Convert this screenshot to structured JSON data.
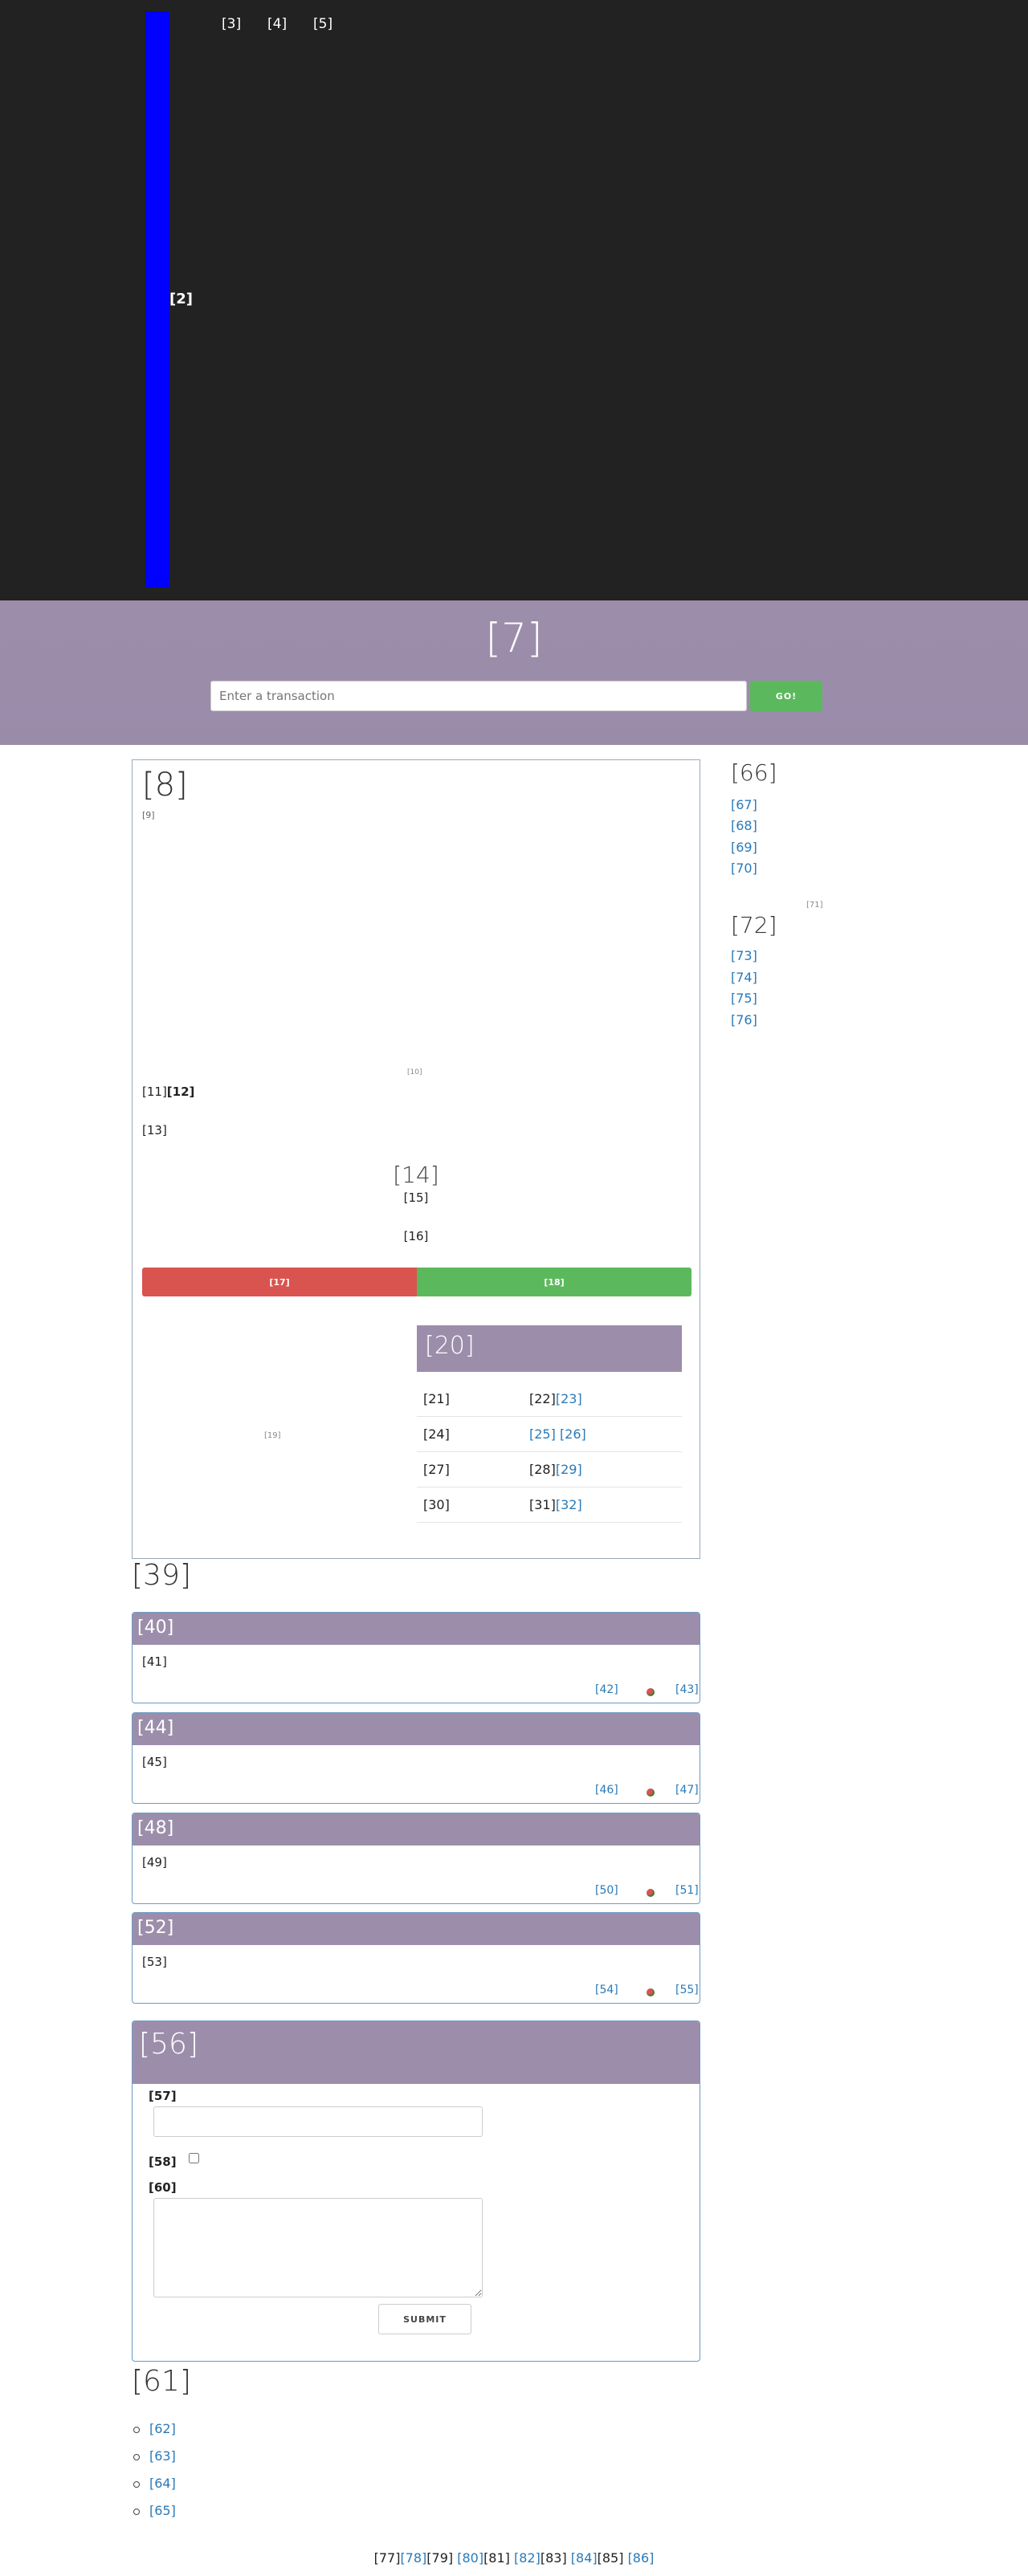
{
  "nav": {
    "brand": "[2]",
    "items": [
      "[3]",
      "[4]",
      "[5]"
    ]
  },
  "hero": {
    "title": "[7]",
    "search_placeholder": "Enter a transaction",
    "go_label": "GO!"
  },
  "main": {
    "title": "[8]",
    "caption": "[9]",
    "img_caption": "[10]",
    "line1_a": "[11]",
    "line1_b": "[12]",
    "line2": "[13]",
    "subtitle": "[14]",
    "sub1": "[15]",
    "sub2": "[16]",
    "progress": {
      "red_label": "[17]",
      "green_label": "[18]",
      "red_fraction": 0.5,
      "green_fraction": 0.5
    },
    "left_caption": "[19]",
    "table": {
      "header": "[20]",
      "rows": [
        {
          "k": "[21]",
          "v": "[22]",
          "links": [
            "[23]"
          ]
        },
        {
          "k": "[24]",
          "v": "",
          "links": [
            "[25]",
            "[26]"
          ]
        },
        {
          "k": "[27]",
          "v": "[28]",
          "links": [
            "[29]"
          ]
        },
        {
          "k": "[30]",
          "v": "[31]",
          "links": [
            "[32]"
          ]
        }
      ]
    }
  },
  "section39": {
    "title": "[39]",
    "cards": [
      {
        "header": "[40]",
        "body": "[41]",
        "link1": "[42]",
        "link2": "[43]"
      },
      {
        "header": "[44]",
        "body": "[45]",
        "link1": "[46]",
        "link2": "[47]"
      },
      {
        "header": "[48]",
        "body": "[49]",
        "link1": "[50]",
        "link2": "[51]"
      },
      {
        "header": "[52]",
        "body": "[53]",
        "link1": "[54]",
        "link2": "[55]"
      }
    ]
  },
  "form": {
    "header": "[56]",
    "field1_label": "[57]",
    "checkbox_label": "[58]",
    "textarea_label": "[60]",
    "submit_label": "SUBMIT"
  },
  "section61": {
    "title": "[61]",
    "items": [
      "[62]",
      "[63]",
      "[64]",
      "[65]"
    ]
  },
  "sidebar": {
    "block1_title": "[66]",
    "block1_links": [
      "[67]",
      "[68]",
      "[69]",
      "[70]"
    ],
    "small_caption": "[71]",
    "block2_title": "[72]",
    "block2_links": [
      "[73]",
      "[74]",
      "[75]",
      "[76]"
    ]
  },
  "footer": {
    "t77": "[77]",
    "l78": "[78]",
    "t79": "[79]",
    "l80": "[80]",
    "t81": "[81]",
    "l82": "[82]",
    "t83": "[83]",
    "l84": "[84]",
    "t85": "[85]",
    "l86": "[86]"
  }
}
